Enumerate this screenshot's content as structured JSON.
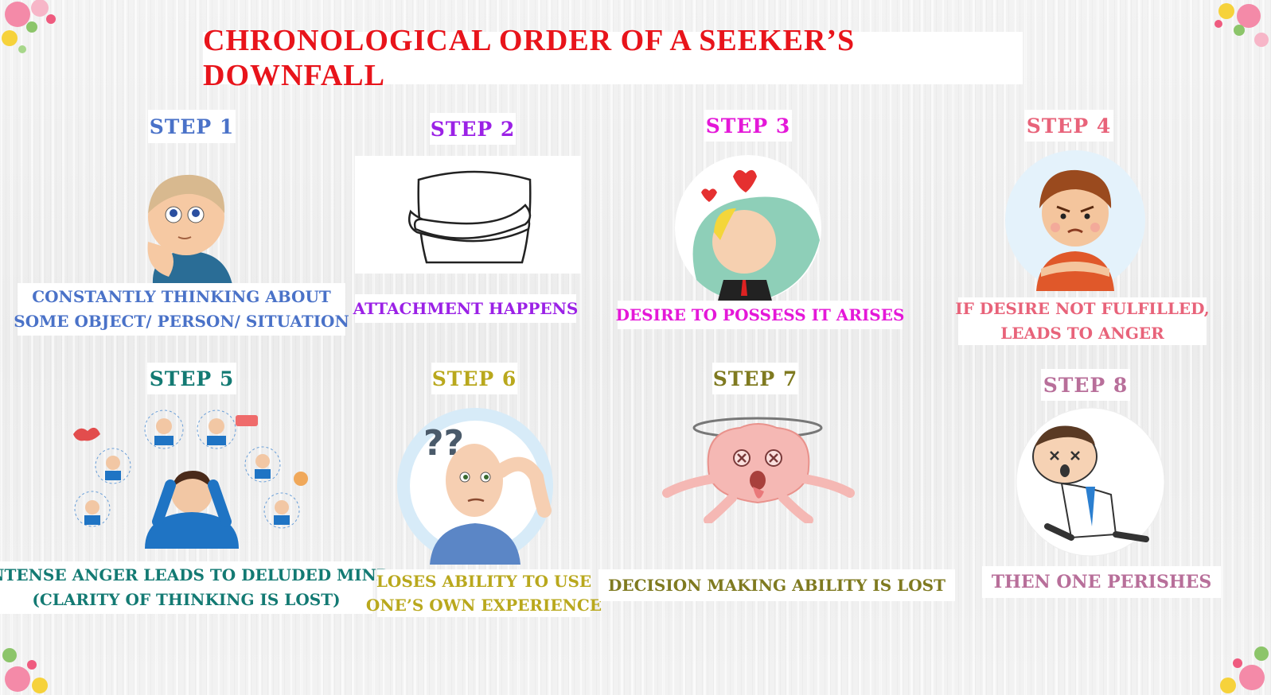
{
  "title": "CHRONOLOGICAL ORDER OF A SEEKER’S DOWNFALL",
  "colors": {
    "title": "#e8141b",
    "step1": "#4a72c8",
    "step2": "#9b21e6",
    "step3": "#e418d8",
    "step4": "#e8637a",
    "step5": "#137a73",
    "step6": "#b9a81d",
    "step7": "#7f7a20",
    "step8": "#b86f9a"
  },
  "steps": [
    {
      "label": "STEP 1",
      "caption_lines": [
        "CONSTANTLY THINKING ABOUT",
        "SOME OBJECT/ PERSON/ SITUATION"
      ],
      "image": "thinking-boy"
    },
    {
      "label": "STEP 2",
      "caption_lines": [
        "ATTACHMENT HAPPENS"
      ],
      "image": "crossed-arms-hug"
    },
    {
      "label": "STEP 3",
      "caption_lines": [
        "DESIRE TO POSSESS IT ARISES"
      ],
      "image": "boy-with-hearts"
    },
    {
      "label": "STEP 4",
      "caption_lines": [
        "IF DESIRE NOT FULFILLED,",
        "LEADS TO ANGER"
      ],
      "image": "angry-boy"
    },
    {
      "label": "STEP 5",
      "caption_lines": [
        "INTENSE ANGER LEADS TO DELUDED MIND",
        "(CLARITY OF THINKING IS LOST)"
      ],
      "image": "stressed-man-cluster"
    },
    {
      "label": "STEP 6",
      "caption_lines": [
        "LOSES ABILITY TO USE",
        "ONE’S OWN EXPERIENCE"
      ],
      "image": "confused-man"
    },
    {
      "label": "STEP 7",
      "caption_lines": [
        "DECISION MAKING ABILITY IS LOST"
      ],
      "image": "dizzy-brain"
    },
    {
      "label": "STEP 8",
      "caption_lines": [
        "THEN ONE PERISHES"
      ],
      "image": "collapsed-man"
    }
  ]
}
